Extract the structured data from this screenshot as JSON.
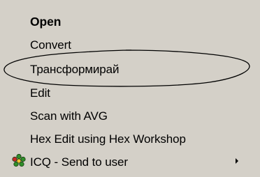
{
  "context_menu": {
    "items": [
      {
        "label": "Open",
        "default": true
      },
      {
        "label": "Convert"
      },
      {
        "label": "Трансформирай"
      },
      {
        "label": "Edit"
      },
      {
        "label": "Scan with AVG"
      },
      {
        "label": "Hex Edit using Hex Workshop"
      },
      {
        "label": "ICQ - Send to user",
        "icon": "icq-flower-icon",
        "has_submenu": true
      }
    ]
  },
  "colors": {
    "menu_background": "#d4d0c8",
    "text": "#000000",
    "annotation_ellipse": "#000000"
  }
}
